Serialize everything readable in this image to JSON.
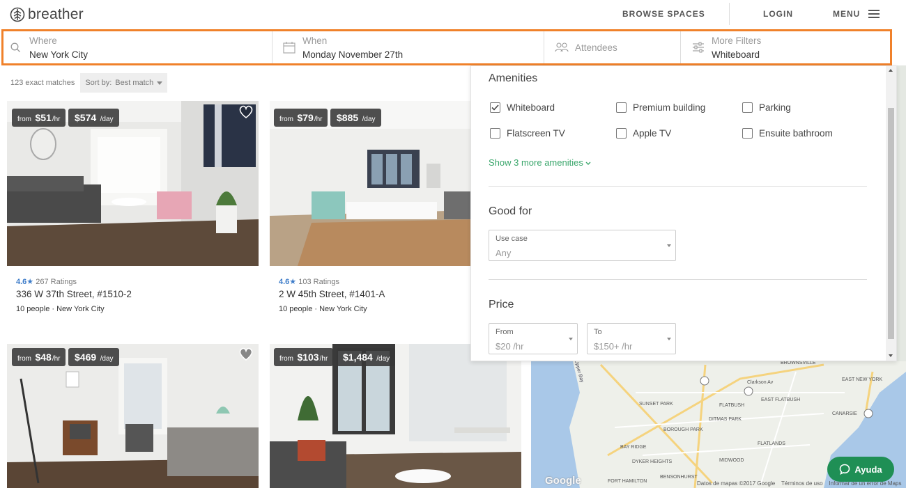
{
  "brand": {
    "name": "breather"
  },
  "nav": {
    "browse": "BROWSE SPACES",
    "login": "LOGIN",
    "menu": "MENU"
  },
  "search": {
    "where_label": "Where",
    "where_value": "New York City",
    "when_label": "When",
    "when_value": "Monday November 27th",
    "attendees_label": "Attendees",
    "filters_label": "More Filters",
    "filters_value": "Whiteboard"
  },
  "results": {
    "count": "123 exact matches",
    "sort_label": "Sort by:",
    "sort_value": "Best match"
  },
  "listings": [
    {
      "from": "from",
      "hourly": "$51",
      "per_hr": "/hr",
      "daily": "$574",
      "per_day": "/day",
      "rating": "4.6",
      "ratings": "267 Ratings",
      "address": "336 W 37th Street, #1510-2",
      "people": "10 people",
      "city": "New York City"
    },
    {
      "from": "from",
      "hourly": "$79",
      "per_hr": "/hr",
      "daily": "$885",
      "per_day": "/day",
      "rating": "4.6",
      "ratings": "103 Ratings",
      "address": "2 W 45th Street, #1401-A",
      "people": "10 people",
      "city": "New York City"
    },
    {
      "from": "from",
      "hourly": "$48",
      "per_hr": "/hr",
      "daily": "$469",
      "per_day": "/day"
    },
    {
      "from": "from",
      "hourly": "$103",
      "per_hr": "/hr",
      "daily": "$1,484",
      "per_day": "/day"
    }
  ],
  "filters": {
    "amenities_title": "Amenities",
    "amenities": [
      {
        "label": "Whiteboard",
        "checked": true
      },
      {
        "label": "Premium building",
        "checked": false
      },
      {
        "label": "Parking",
        "checked": false
      },
      {
        "label": "Flatscreen TV",
        "checked": false
      },
      {
        "label": "Apple TV",
        "checked": false
      },
      {
        "label": "Ensuite bathroom",
        "checked": false
      }
    ],
    "show_more": "Show 3 more amenities",
    "good_for_title": "Good for",
    "use_case_label": "Use case",
    "use_case_value": "Any",
    "price_title": "Price",
    "from_label": "From",
    "from_value": "$20 /hr",
    "to_label": "To",
    "to_value": "$150+ /hr"
  },
  "map": {
    "labels": [
      "BROWNSVILLE",
      "EAST NEW YORK",
      "Clarkson Av",
      "SUNSET PARK",
      "FLATBUSH",
      "DITMAS PARK",
      "EAST FLATBUSH",
      "CANARSIE",
      "BAY RIDGE",
      "BOROUGH PARK",
      "FLATLANDS",
      "DYKER HEIGHTS",
      "MIDWOOD",
      "BENSONHURST",
      "FORT HAMILTON",
      "Upper Bay"
    ],
    "attribution": "Datos de mapas ©2017 Google",
    "terms": "Términos de uso",
    "report": "Informar de un error de Maps",
    "google": "Google"
  },
  "help": {
    "label": "Ayuda"
  },
  "colors": {
    "accent_orange": "#f0812a",
    "green": "#3aa66b",
    "help_green": "#1f8f55",
    "rating_blue": "#3d7cc9"
  }
}
